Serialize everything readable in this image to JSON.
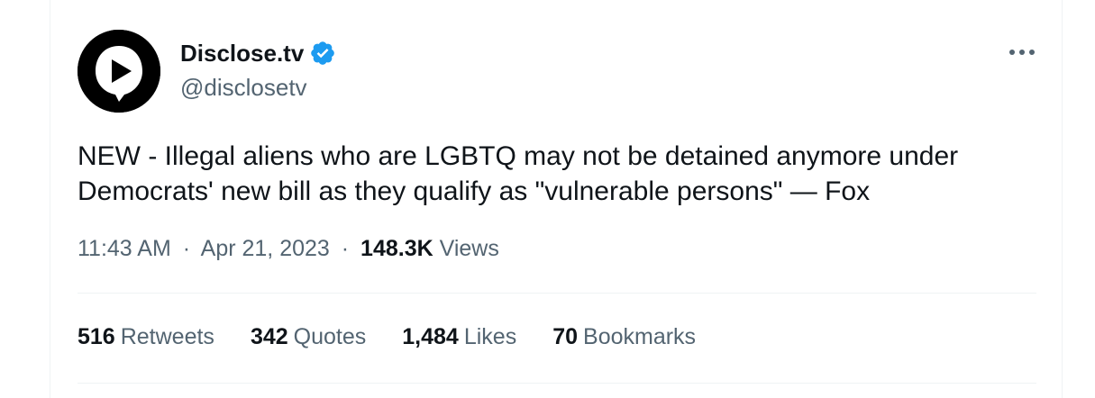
{
  "author": {
    "display_name": "Disclose.tv",
    "handle": "@disclosetv",
    "verified": true,
    "avatar_icon": "disclosetv-logo-icon"
  },
  "tweet": {
    "text": "NEW - Illegal aliens who are LGBTQ may not be detained anymore under\nDemocrats' new bill as they qualify as \"vulnerable persons\" — Fox",
    "time": "11:43 AM",
    "date": "Apr 21, 2023",
    "separator": "·",
    "views_count": "148.3K",
    "views_label": "Views"
  },
  "stats": [
    {
      "count": "516",
      "label": "Retweets"
    },
    {
      "count": "342",
      "label": "Quotes"
    },
    {
      "count": "1,484",
      "label": "Likes"
    },
    {
      "count": "70",
      "label": "Bookmarks"
    }
  ],
  "colors": {
    "primary_text": "#0f1419",
    "secondary_text": "#536471",
    "verified_blue": "#1d9bf0",
    "divider": "#eff3f4"
  },
  "icons": {
    "more": "more-options-icon",
    "verified": "verified-badge-icon"
  }
}
